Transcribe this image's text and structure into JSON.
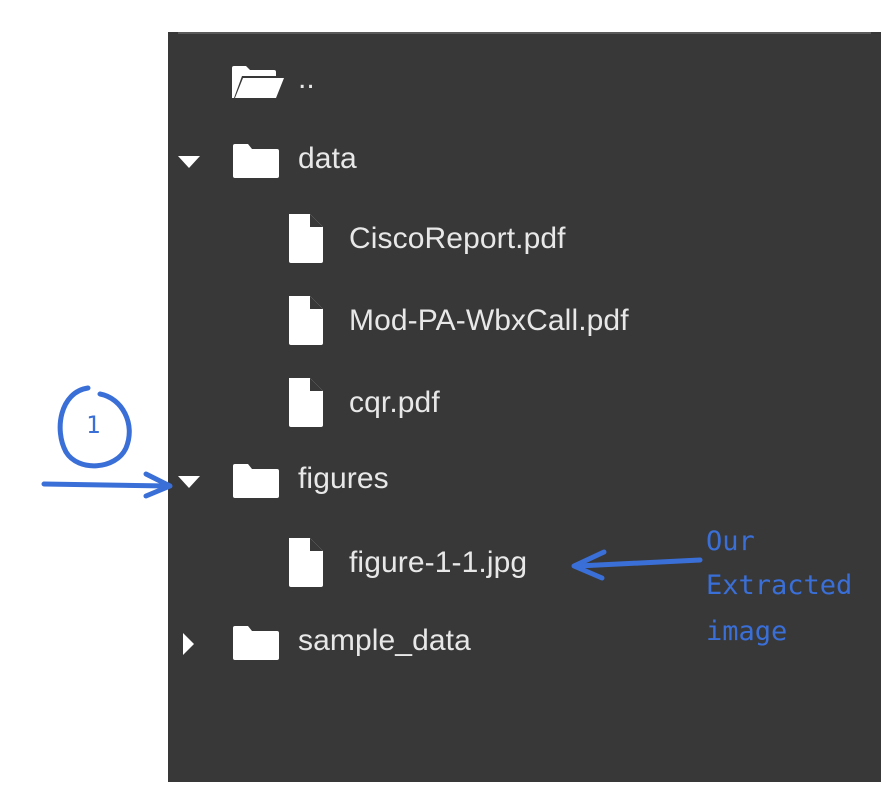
{
  "tree": {
    "items": [
      {
        "label": "..",
        "kind": "parent-folder",
        "expanded": null,
        "icon": "folder-open-icon"
      },
      {
        "label": "data",
        "kind": "folder",
        "expanded": true,
        "icon": "folder-icon"
      },
      {
        "label": "CiscoReport.pdf",
        "kind": "file",
        "icon": "file-icon"
      },
      {
        "label": "Mod-PA-WbxCall.pdf",
        "kind": "file",
        "icon": "file-icon"
      },
      {
        "label": "cqr.pdf",
        "kind": "file",
        "icon": "file-icon"
      },
      {
        "label": "figures",
        "kind": "folder",
        "expanded": true,
        "icon": "folder-icon"
      },
      {
        "label": "figure-1-1.jpg",
        "kind": "file",
        "icon": "file-icon"
      },
      {
        "label": "sample_data",
        "kind": "folder",
        "expanded": false,
        "icon": "folder-icon"
      }
    ]
  },
  "annotations": {
    "step_number": "1",
    "note_line1": "Our",
    "note_line2": "Extracted",
    "note_line3": "image",
    "color": "#3a6fd8"
  },
  "colors": {
    "panel_bg": "#383838",
    "text": "#e8e8e8",
    "icon": "#ffffff"
  }
}
